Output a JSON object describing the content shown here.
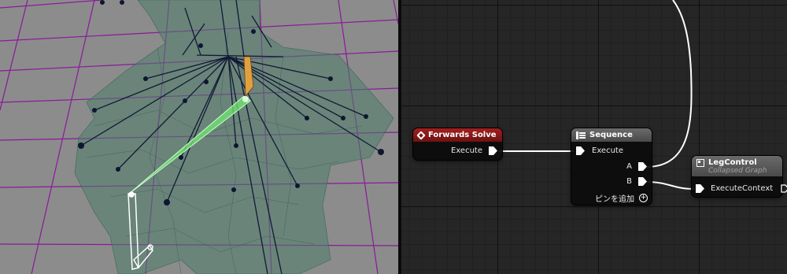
{
  "nodes": {
    "forwards_solve": {
      "title": "Forwards Solve",
      "pin_execute": "Execute",
      "header_color": "#8f1a1a"
    },
    "sequence": {
      "title": "Sequence",
      "pin_execute": "Execute",
      "pin_a": "A",
      "pin_b": "B",
      "add_pin_label": "ピンを追加",
      "header_color": "#5a5a5a"
    },
    "leg_control": {
      "title": "LegControl",
      "subtitle": "Collapsed Graph",
      "pin_execute_context": "ExecuteContext",
      "header_color": "#5a5a5a"
    }
  },
  "colors": {
    "viewport_bg": "#8c8c8c",
    "grid_lines": "#8a1a9a",
    "mesh": "#3f6e5e",
    "bones": "#111a33",
    "selected_bone": "#7cf07c",
    "graph_bg": "#262626"
  },
  "icons": [
    "event-diamond-icon",
    "sequence-icon",
    "collapsed-graph-icon",
    "add-pin-icon"
  ]
}
